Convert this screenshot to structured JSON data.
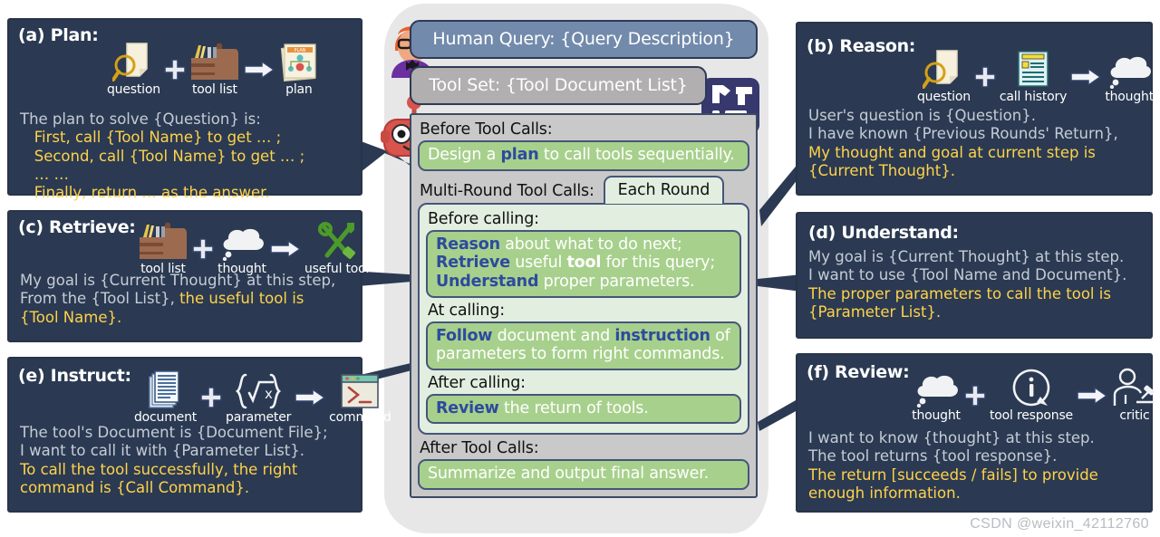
{
  "colors": {
    "panel_bg": "#2b3a52",
    "panel_text": "#c6ccd6",
    "highlight": "#ffd24a",
    "green_bar": "#a7d08c",
    "green_box": "#e2efe0",
    "query_bar": "#728aab",
    "toolset_bar": "#b1afaf",
    "stage_bg": "#c9c9c9",
    "blob_bg": "#e7e7e7",
    "accent_blue": "#2e4a9e"
  },
  "center": {
    "human_query": "Human Query: {Query Description}",
    "tool_set": "Tool Set: {Tool Document List}",
    "toolbox_icon": "toolbox-icon",
    "human_icon": "human-avatar-icon",
    "robot_icon": "robot-avatar-icon",
    "stages": {
      "before_label": "Before Tool Calls:",
      "before_text_parts": [
        {
          "t": "Design a ",
          "s": "plain"
        },
        {
          "t": "plan",
          "s": "bold-blue"
        },
        {
          "t": " to call tools sequentially.",
          "s": "plain"
        }
      ],
      "multi_label": "Multi-Round Tool Calls:",
      "each_round_tab": "Each Round",
      "rounds": [
        {
          "label": "Before calling:",
          "lines": [
            [
              {
                "t": "Reason",
                "s": "bold-blue"
              },
              {
                "t": " about what to do next;",
                "s": "plain"
              }
            ],
            [
              {
                "t": "Retrieve",
                "s": "bold-blue"
              },
              {
                "t": " useful ",
                "s": "plain"
              },
              {
                "t": "tool",
                "s": "bold-white"
              },
              {
                "t": " for this query;",
                "s": "plain"
              }
            ],
            [
              {
                "t": "Understand",
                "s": "bold-blue"
              },
              {
                "t": " proper parameters.",
                "s": "plain"
              }
            ]
          ]
        },
        {
          "label": "At calling:",
          "lines": [
            [
              {
                "t": "Follow",
                "s": "bold-blue"
              },
              {
                "t": " document and ",
                "s": "plain"
              },
              {
                "t": "instruction",
                "s": "bold-blue"
              },
              {
                "t": " of",
                "s": "plain"
              }
            ],
            [
              {
                "t": "parameters to form right commands.",
                "s": "plain"
              }
            ]
          ]
        },
        {
          "label": "After calling:",
          "lines": [
            [
              {
                "t": "Review",
                "s": "bold-blue"
              },
              {
                "t": " the return of tools.",
                "s": "plain"
              }
            ]
          ]
        }
      ],
      "after_label": "After Tool Calls:",
      "after_text_parts": [
        {
          "t": "Summarize and output final answer.",
          "s": "plain"
        }
      ]
    }
  },
  "panels": [
    {
      "id": "plan",
      "title": "(a) Plan:",
      "icons": [
        {
          "name": "question-magnifier-icon",
          "caption": "question"
        },
        {
          "name": "plus-icon",
          "caption": ""
        },
        {
          "name": "toolbox-icon",
          "caption": "tool list"
        },
        {
          "name": "arrow-right-icon",
          "caption": ""
        },
        {
          "name": "plan-document-icon",
          "caption": "plan"
        }
      ],
      "lines": [
        [
          {
            "t": "The plan to solve {Question} is:",
            "s": "plain"
          }
        ],
        [
          {
            "t": "   First, call {Tool Name} to get … ;",
            "s": "hl"
          }
        ],
        [
          {
            "t": "   Second, call {Tool Name} to get … ;",
            "s": "hl"
          }
        ],
        [
          {
            "t": "   … …",
            "s": "hl"
          }
        ],
        [
          {
            "t": "   Finally, return … as the answer.",
            "s": "hl"
          }
        ]
      ]
    },
    {
      "id": "reason",
      "title": "(b) Reason:",
      "icons": [
        {
          "name": "question-magnifier-icon",
          "caption": "question"
        },
        {
          "name": "plus-icon",
          "caption": ""
        },
        {
          "name": "call-history-icon",
          "caption": "call history"
        },
        {
          "name": "arrow-right-icon",
          "caption": ""
        },
        {
          "name": "thought-cloud-icon",
          "caption": "thought"
        }
      ],
      "lines": [
        [
          {
            "t": "User's question is {Question}.",
            "s": "plain"
          }
        ],
        [
          {
            "t": "I have known {Previous Rounds' Return},",
            "s": "plain"
          }
        ],
        [
          {
            "t": "My thought and goal at current step is",
            "s": "hl"
          }
        ],
        [
          {
            "t": "{Current Thought}.",
            "s": "hl"
          }
        ]
      ]
    },
    {
      "id": "retrieve",
      "title": "(c) Retrieve:",
      "icons": [
        {
          "name": "toolbox-icon",
          "caption": "tool list"
        },
        {
          "name": "plus-icon",
          "caption": ""
        },
        {
          "name": "thought-cloud-icon",
          "caption": "thought"
        },
        {
          "name": "arrow-right-icon",
          "caption": ""
        },
        {
          "name": "wrench-screwdriver-icon",
          "caption": "useful tool"
        }
      ],
      "lines": [
        [
          {
            "t": "My goal is {Current Thought} at this step,",
            "s": "plain"
          }
        ],
        [
          {
            "t": "From the {Tool List}, ",
            "s": "plain"
          },
          {
            "t": "the useful tool is",
            "s": "hl"
          }
        ],
        [
          {
            "t": "{Tool Name}.",
            "s": "hl"
          }
        ]
      ]
    },
    {
      "id": "understand",
      "title": "(d) Understand:",
      "icons": [],
      "lines": [
        [
          {
            "t": "My goal is {Current Thought} at this step.",
            "s": "plain"
          }
        ],
        [
          {
            "t": "I want to use {Tool Name and Document}.",
            "s": "plain"
          }
        ],
        [
          {
            "t": "The proper parameters to call the tool is",
            "s": "hl"
          }
        ],
        [
          {
            "t": "{Parameter List}.",
            "s": "hl"
          }
        ]
      ]
    },
    {
      "id": "instruct",
      "title": "(e) Instruct:",
      "icons": [
        {
          "name": "document-stack-icon",
          "caption": "document"
        },
        {
          "name": "plus-icon",
          "caption": ""
        },
        {
          "name": "parameter-formula-icon",
          "caption": "parameter"
        },
        {
          "name": "arrow-right-icon",
          "caption": ""
        },
        {
          "name": "terminal-window-icon",
          "caption": "command"
        }
      ],
      "lines": [
        [
          {
            "t": "The tool's Document is {Document File};",
            "s": "plain"
          }
        ],
        [
          {
            "t": "I want to call it with {Parameter List}.",
            "s": "plain"
          }
        ],
        [
          {
            "t": "To call the tool successfully, the right",
            "s": "hl"
          }
        ],
        [
          {
            "t": "command is {Call Command}.",
            "s": "hl"
          }
        ]
      ]
    },
    {
      "id": "review",
      "title": "(f) Review:",
      "icons": [
        {
          "name": "thought-cloud-icon",
          "caption": "thought"
        },
        {
          "name": "plus-icon",
          "caption": ""
        },
        {
          "name": "info-bubble-icon",
          "caption": "tool response"
        },
        {
          "name": "arrow-right-icon",
          "caption": ""
        },
        {
          "name": "critic-judge-icon",
          "caption": "critic"
        }
      ],
      "lines": [
        [
          {
            "t": "I want to know {thought} at this step.",
            "s": "plain"
          }
        ],
        [
          {
            "t": "The tool returns {tool response}.",
            "s": "plain"
          }
        ],
        [
          {
            "t": "The return [succeeds / fails] to provide",
            "s": "hl"
          }
        ],
        [
          {
            "t": "enough information.",
            "s": "hl"
          }
        ]
      ]
    }
  ],
  "watermark": "CSDN @weixin_42112760"
}
